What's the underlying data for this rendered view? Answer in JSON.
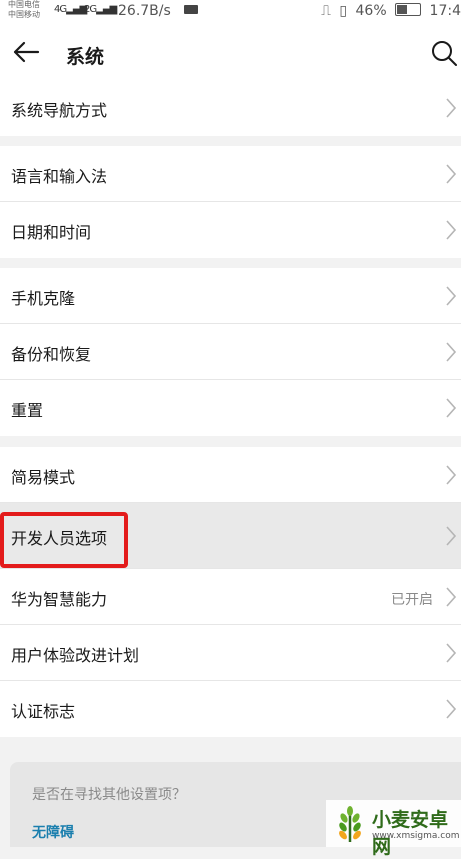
{
  "status_bar": {
    "carrier_1": "中国电信",
    "carrier_2": "中国移动",
    "signal_1": "4G",
    "signal_2": "2G",
    "net_speed": "26.7B/s",
    "battery_percent": "46%",
    "time": "17:4"
  },
  "header": {
    "title": "系统",
    "back_icon": "arrow-left-icon",
    "search_icon": "search-icon"
  },
  "groups": [
    {
      "items": [
        {
          "label": "系统导航方式"
        }
      ]
    },
    {
      "items": [
        {
          "label": "语言和输入法"
        },
        {
          "label": "日期和时间"
        }
      ]
    },
    {
      "items": [
        {
          "label": "手机克隆"
        },
        {
          "label": "备份和恢复"
        },
        {
          "label": "重置"
        }
      ]
    },
    {
      "items": [
        {
          "label": "简易模式"
        },
        {
          "label": "开发人员选项",
          "highlighted": true
        },
        {
          "label": "华为智慧能力",
          "value": "已开启"
        },
        {
          "label": "用户体验改进计划"
        },
        {
          "label": "认证标志"
        }
      ]
    }
  ],
  "suggestion": {
    "question": "是否在寻找其他设置项？",
    "link": "无障碍"
  },
  "watermark": {
    "title": "小麦安卓网",
    "url": "www.xmsigma.com"
  },
  "colors": {
    "highlight": "#e31b1b",
    "link": "#1b7fae",
    "background": "#f2f2f2"
  }
}
